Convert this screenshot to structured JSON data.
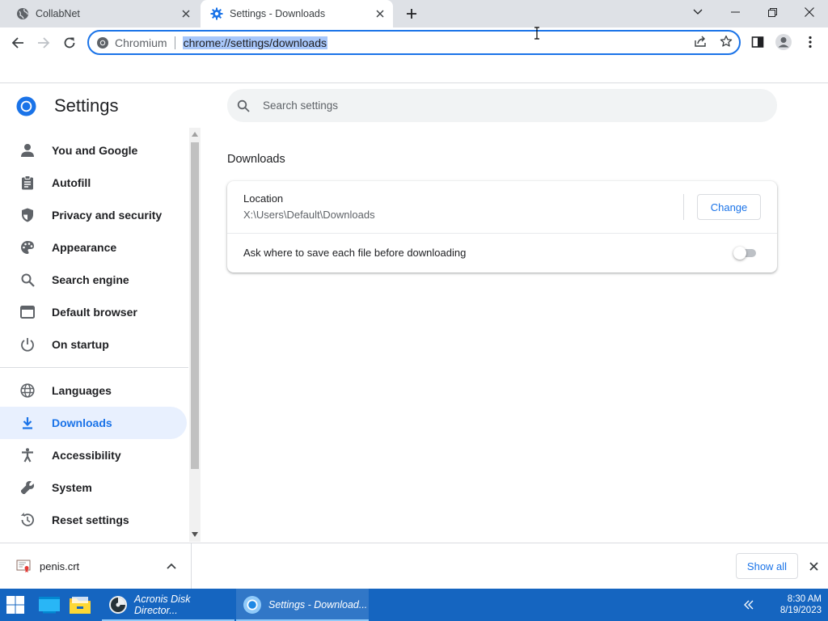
{
  "browser": {
    "tabs": [
      {
        "title": "CollabNet",
        "active": false
      },
      {
        "title": "Settings - Downloads",
        "active": true
      }
    ],
    "omnibox": {
      "site_chip": "Chromium",
      "url": "chrome://settings/downloads"
    }
  },
  "settings": {
    "title": "Settings",
    "search_placeholder": "Search settings",
    "nav": [
      {
        "label": "You and Google",
        "icon": "person-icon"
      },
      {
        "label": "Autofill",
        "icon": "clipboard-icon"
      },
      {
        "label": "Privacy and security",
        "icon": "shield-icon"
      },
      {
        "label": "Appearance",
        "icon": "palette-icon"
      },
      {
        "label": "Search engine",
        "icon": "search-icon"
      },
      {
        "label": "Default browser",
        "icon": "browser-window-icon"
      },
      {
        "label": "On startup",
        "icon": "power-icon"
      },
      {
        "label": "Languages",
        "icon": "globe-icon"
      },
      {
        "label": "Downloads",
        "icon": "download-icon",
        "selected": true
      },
      {
        "label": "Accessibility",
        "icon": "accessibility-icon"
      },
      {
        "label": "System",
        "icon": "wrench-icon"
      },
      {
        "label": "Reset settings",
        "icon": "history-icon"
      }
    ]
  },
  "downloads": {
    "section_title": "Downloads",
    "location_label": "Location",
    "location_path": "X:\\Users\\Default\\Downloads",
    "change_button": "Change",
    "ask_label": "Ask where to save each file before downloading",
    "ask_enabled": false
  },
  "shelf": {
    "file_name": "penis.crt",
    "show_all": "Show all"
  },
  "taskbar": {
    "apps": [
      {
        "label": "Acronis Disk Director...",
        "icon": "acronis-icon"
      },
      {
        "label": "Settings - Download...",
        "icon": "chromium-icon",
        "active": true
      }
    ],
    "time": "8:30 AM",
    "date": "8/19/2023"
  },
  "colors": {
    "accent": "#1a73e8",
    "taskbar": "#1565c0",
    "tabstrip": "#dee1e6",
    "selected_nav_bg": "#e8f0fe"
  }
}
